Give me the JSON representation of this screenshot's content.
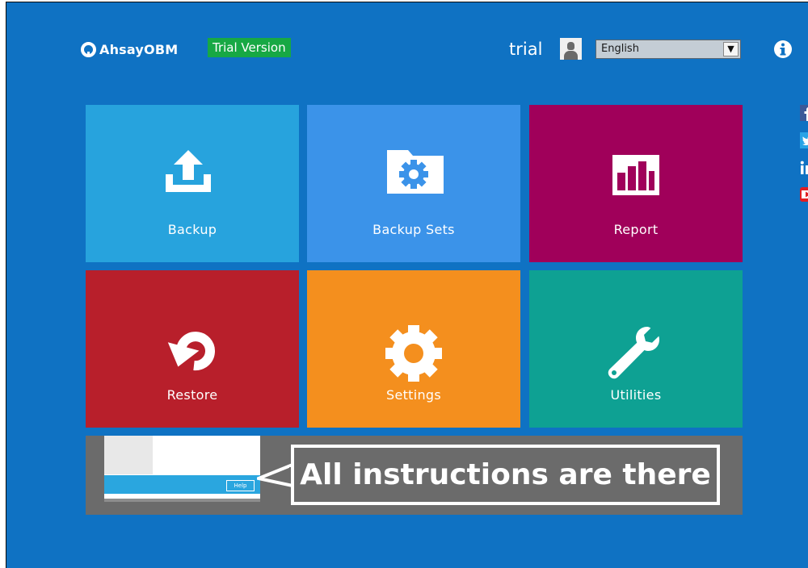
{
  "header": {
    "app_name": "AhsayOBM",
    "trial_badge": "Trial Version",
    "username": "trial",
    "language": {
      "selected": "English"
    }
  },
  "tiles": [
    {
      "label": "Backup",
      "color": "#27a3dd",
      "icon": "upload-icon"
    },
    {
      "label": "Backup Sets",
      "color": "#3b93e9",
      "icon": "folder-gear-icon"
    },
    {
      "label": "Report",
      "color": "#a0005a",
      "icon": "bar-chart-icon"
    },
    {
      "label": "Restore",
      "color": "#b81f2b",
      "icon": "restore-icon"
    },
    {
      "label": "Settings",
      "color": "#f48f1e",
      "icon": "gear-icon"
    },
    {
      "label": "Utilities",
      "color": "#0ea193",
      "icon": "wrench-icon"
    }
  ],
  "banner": {
    "help_button": "Help",
    "callout": "All instructions are there"
  },
  "social": [
    "facebook-icon",
    "twitter-icon",
    "linkedin-icon",
    "youtube-icon"
  ],
  "colors": {
    "background": "#0f72c3",
    "trial_badge": "#17a844"
  }
}
